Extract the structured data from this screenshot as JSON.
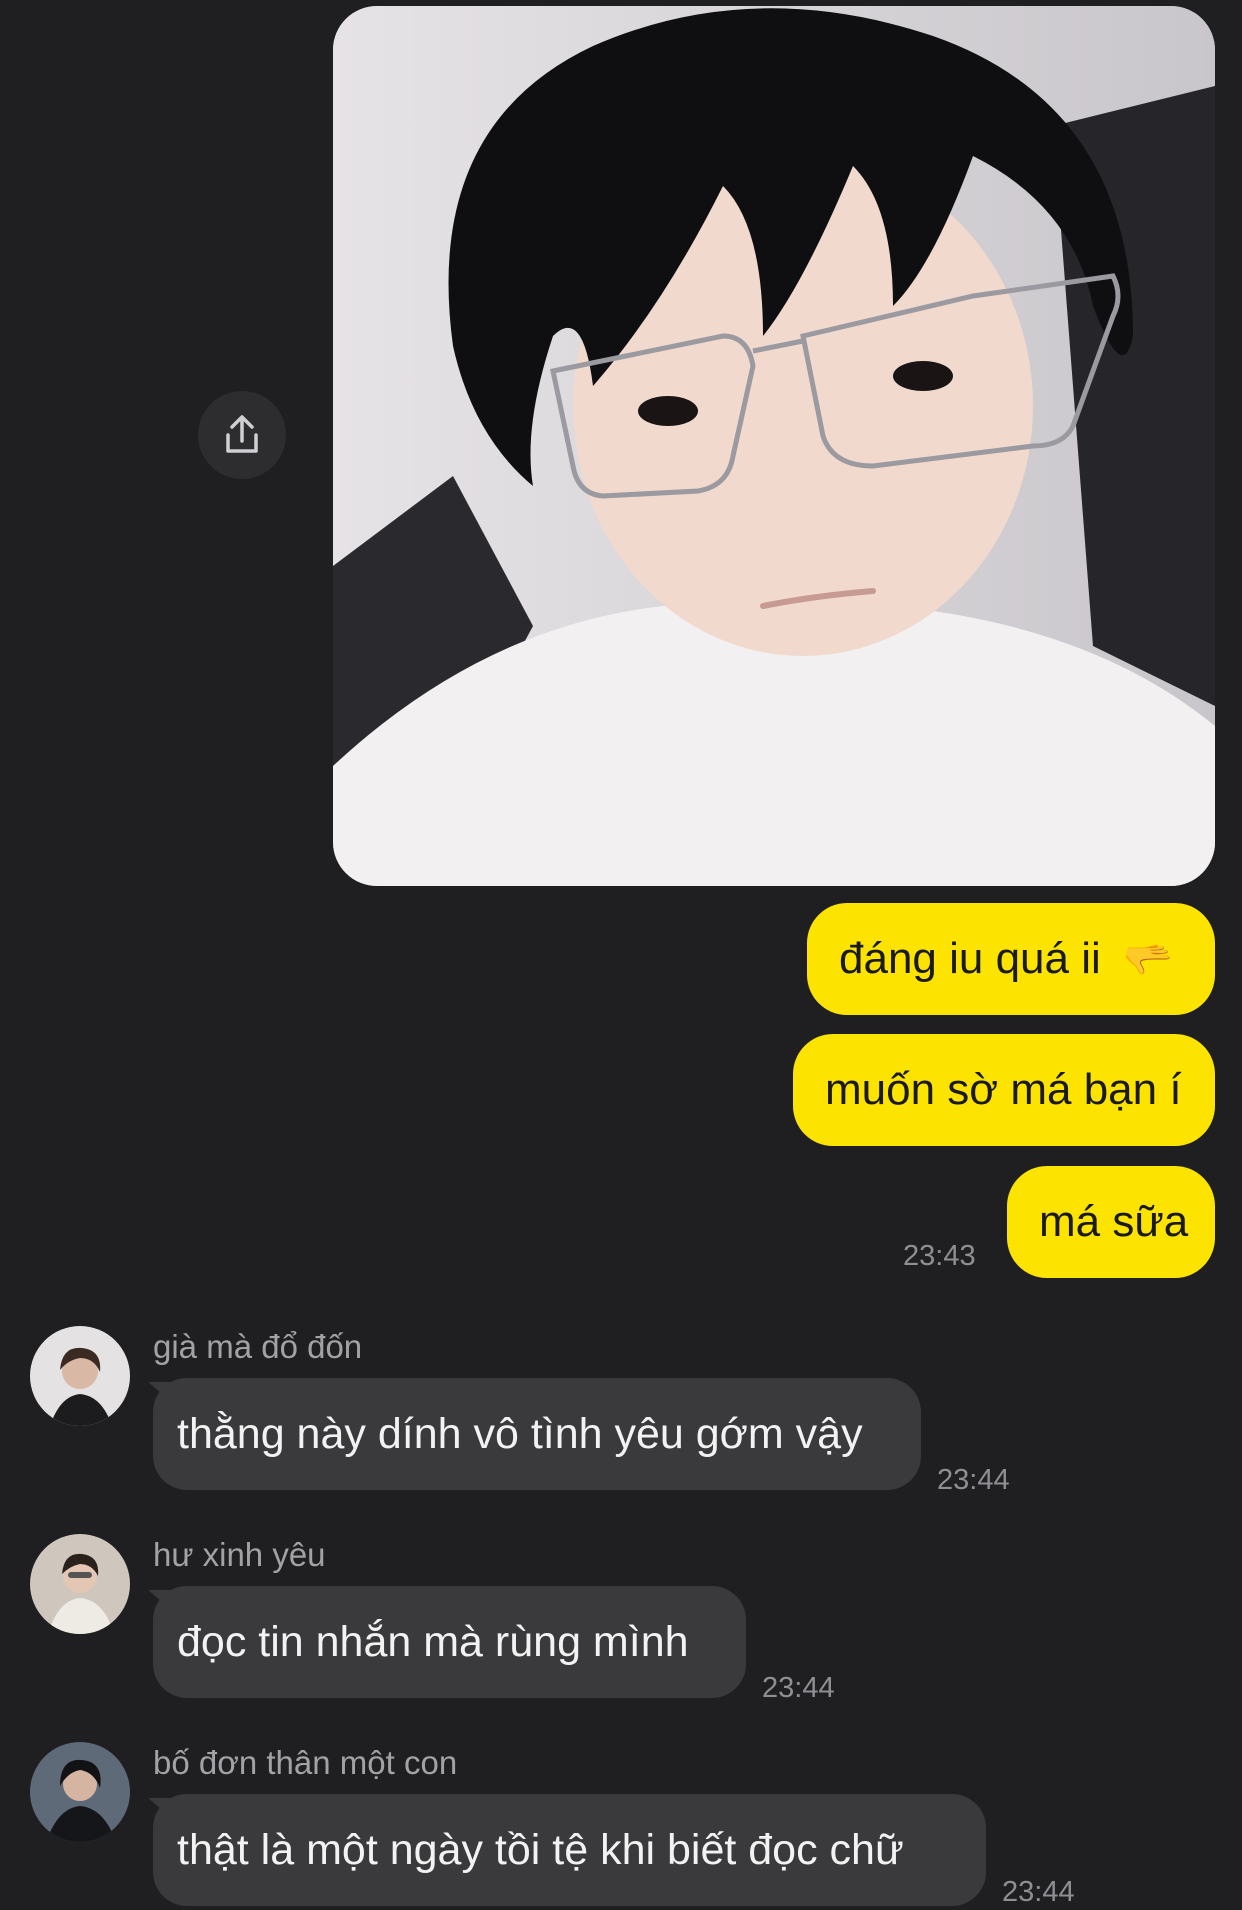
{
  "photo_message": {
    "share_icon": "share-icon"
  },
  "outgoing_messages": [
    {
      "text": "đáng iu quá ii",
      "emoji": "🫳"
    },
    {
      "text": "muốn sờ má bạn í"
    },
    {
      "text": "má sữa",
      "time": "23:43"
    }
  ],
  "incoming_messages": [
    {
      "sender": "già mà đổ đốn",
      "text": "thằng này dính vô tình yêu gớm vậy",
      "time": "23:44"
    },
    {
      "sender": "hư xinh yêu",
      "text": "đọc tin nhắn mà rùng mình",
      "time": "23:44"
    },
    {
      "sender": "bố đơn thân một con",
      "text": "thật là một ngày tồi tệ khi biết đọc chữ",
      "time": "23:44"
    }
  ],
  "colors": {
    "background": "#1f1f21",
    "outgoing_bubble": "#fde400",
    "incoming_bubble": "#3a3a3d"
  }
}
